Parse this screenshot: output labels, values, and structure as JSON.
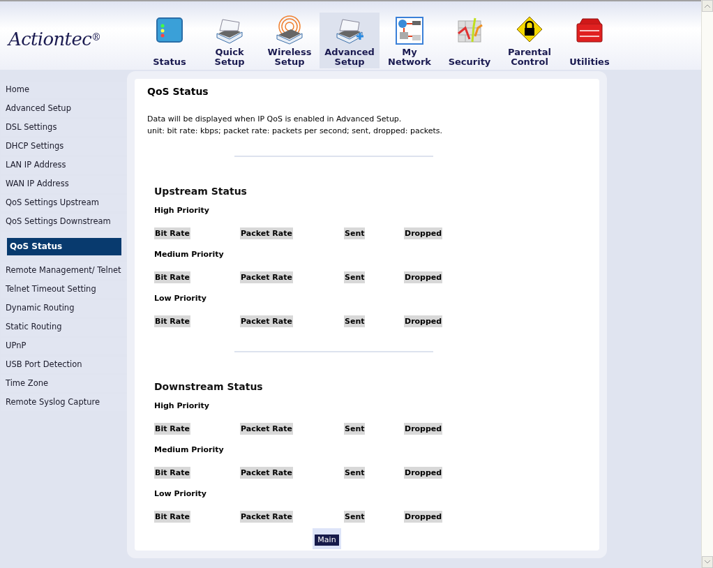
{
  "logo": {
    "text": "Actiontec",
    "mark": "®"
  },
  "nav": [
    {
      "label": "Status",
      "kind": "status",
      "selected": false
    },
    {
      "label": "Quick Setup",
      "kind": "router",
      "selected": false
    },
    {
      "label": "Wireless Setup",
      "kind": "wireless",
      "selected": false
    },
    {
      "label": "Advanced Setup",
      "kind": "router-plus",
      "selected": true
    },
    {
      "label": "My Network",
      "kind": "network",
      "selected": false
    },
    {
      "label": "Security",
      "kind": "firewall",
      "selected": false
    },
    {
      "label": "Parental Control",
      "kind": "lock",
      "selected": false
    },
    {
      "label": "Utilities",
      "kind": "toolbox",
      "selected": false
    }
  ],
  "sidebar": {
    "items": [
      {
        "label": "Home",
        "selected": false
      },
      {
        "label": "Advanced Setup",
        "selected": false
      },
      {
        "label": "DSL Settings",
        "selected": false
      },
      {
        "label": "DHCP Settings",
        "selected": false
      },
      {
        "label": "LAN IP Address",
        "selected": false
      },
      {
        "label": "WAN IP Address",
        "selected": false
      },
      {
        "label": "QoS Settings Upstream",
        "selected": false
      },
      {
        "label": "QoS Settings Downstream",
        "selected": false
      },
      {
        "label": "QoS Status",
        "selected": true
      },
      {
        "label": "Remote Management/ Telnet",
        "selected": false
      },
      {
        "label": "Telnet Timeout Setting",
        "selected": false
      },
      {
        "label": "Dynamic Routing",
        "selected": false
      },
      {
        "label": "Static Routing",
        "selected": false
      },
      {
        "label": "UPnP",
        "selected": false
      },
      {
        "label": "USB Port Detection",
        "selected": false
      },
      {
        "label": "Time Zone",
        "selected": false
      },
      {
        "label": "Remote Syslog Capture",
        "selected": false
      }
    ]
  },
  "content": {
    "title": "QoS Status",
    "notes": [
      "Data will be displayed when IP QoS is enabled in Advanced Setup.",
      "unit: bit rate: kbps; packet rate: packets per second; sent, dropped: packets."
    ],
    "sections": [
      {
        "title": "Upstream Status",
        "priorities": [
          {
            "label": "High Priority",
            "columns": [
              "Bit Rate",
              "Packet Rate",
              "Sent",
              "Dropped"
            ]
          },
          {
            "label": "Medium Priority",
            "columns": [
              "Bit Rate",
              "Packet Rate",
              "Sent",
              "Dropped"
            ]
          },
          {
            "label": "Low Priority",
            "columns": [
              "Bit Rate",
              "Packet Rate",
              "Sent",
              "Dropped"
            ]
          }
        ]
      },
      {
        "title": "Downstream Status",
        "priorities": [
          {
            "label": "High Priority",
            "columns": [
              "Bit Rate",
              "Packet Rate",
              "Sent",
              "Dropped"
            ]
          },
          {
            "label": "Medium Priority",
            "columns": [
              "Bit Rate",
              "Packet Rate",
              "Sent",
              "Dropped"
            ]
          },
          {
            "label": "Low Priority",
            "columns": [
              "Bit Rate",
              "Packet Rate",
              "Sent",
              "Dropped"
            ]
          }
        ]
      }
    ],
    "button": "Main"
  }
}
